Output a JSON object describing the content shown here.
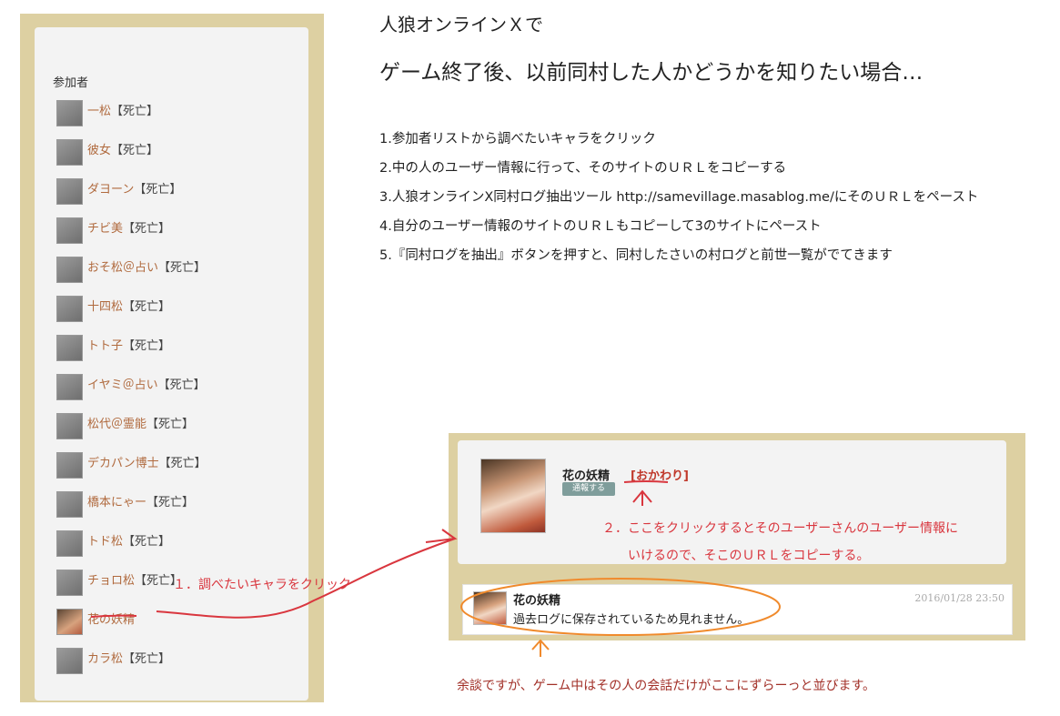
{
  "sidebar": {
    "title": "参加者",
    "participants": [
      {
        "name": "一松",
        "status": "【死亡】"
      },
      {
        "name": "彼女",
        "status": "【死亡】"
      },
      {
        "name": "ダヨーン",
        "status": "【死亡】"
      },
      {
        "name": "チビ美",
        "status": "【死亡】"
      },
      {
        "name": "おそ松＠占い",
        "status": "【死亡】"
      },
      {
        "name": "十四松",
        "status": "【死亡】"
      },
      {
        "name": "トト子",
        "status": "【死亡】"
      },
      {
        "name": "イヤミ＠占い",
        "status": "【死亡】"
      },
      {
        "name": "松代＠霊能",
        "status": "【死亡】"
      },
      {
        "name": "デカパン博士",
        "status": "【死亡】"
      },
      {
        "name": "橋本にゃー",
        "status": "【死亡】"
      },
      {
        "name": "トド松",
        "status": "【死亡】"
      },
      {
        "name": "チョロ松",
        "status": "【死亡】"
      },
      {
        "name": "花の妖精",
        "status": ""
      },
      {
        "name": "カラ松",
        "status": "【死亡】"
      }
    ]
  },
  "guide": {
    "heading1": "人狼オンラインＸで",
    "heading2": "ゲーム終了後、以前同村した人かどうかを知りたい場合…",
    "steps": [
      "1.参加者リストから調べたいキャラをクリック",
      "2.中の人のユーザー情報に行って、そのサイトのＵＲＬをコピーする",
      "3.人狼オンラインX同村ログ抽出ツール http://samevillage.masablog.me/にそのＵＲＬをペースト",
      "4.自分のユーザー情報のサイトのＵＲＬもコピーして3のサイトにペースト",
      "5.『同村ログを抽出』ボタンを押すと、同村したさいの村ログと前世一覧がでてきます"
    ]
  },
  "profile": {
    "name": "花の妖精",
    "report_label": "通報する",
    "okawari_link": "[おかわり]"
  },
  "chat": {
    "name": "花の妖精",
    "time": "2016/01/28 23:50",
    "message": "過去ログに保存されているため見れません。"
  },
  "annotations": {
    "step1": "１．調べたいキャラをクリック",
    "step2_line1": "２．ここをクリックするとそのユーザーさんのユーザー情報に",
    "step2_line2": "いけるので、そこのＵＲＬをコピーする。",
    "aside": "余談ですが、ゲーム中はその人の会話だけがここにずらーっと並びます。"
  },
  "colors": {
    "panel_bg": "#ddd0a2",
    "inner_bg": "#f3f3f3",
    "name_link": "#b06a3e",
    "annotation_red": "#d9363e",
    "circle_orange": "#f08a2c",
    "report_button": "#7f9d9b"
  }
}
